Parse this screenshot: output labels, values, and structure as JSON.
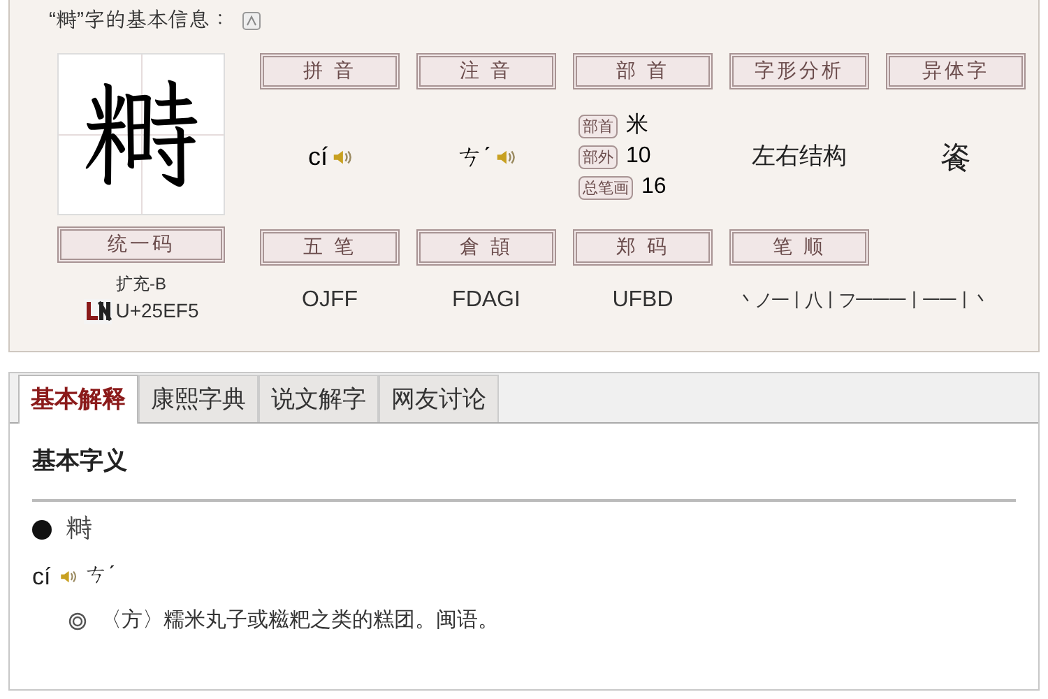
{
  "info_title": "“𥻵”字的基本信息：",
  "character": "𥻵",
  "top_fields": [
    {
      "header": "拼 音",
      "kind": "audio",
      "value": "cí"
    },
    {
      "header": "注 音",
      "kind": "audio",
      "value": "ㄘˊ"
    },
    {
      "header": "部 首",
      "kind": "parts",
      "parts": [
        {
          "tag": "部首",
          "value": "米"
        },
        {
          "tag": "部外",
          "value": "10"
        },
        {
          "tag": "总笔画",
          "value": "16"
        }
      ]
    },
    {
      "header": "字形分析",
      "kind": "text",
      "value": "左右结构"
    },
    {
      "header": "异体字",
      "kind": "large",
      "value": "餈"
    }
  ],
  "unicode": {
    "header": "统一码",
    "block": "扩充-B",
    "code": "U+25EF5"
  },
  "bottom_fields": [
    {
      "header": "五 笔",
      "value": "OJFF"
    },
    {
      "header": "倉 頡",
      "value": "FDAGI"
    },
    {
      "header": "郑 码",
      "value": "UFBD"
    },
    {
      "header": "笔 顺",
      "value": "丶ノ一丨八丨フ一一一丨一一丨丶"
    }
  ],
  "tabs": [
    {
      "label": "基本解释",
      "selected": true
    },
    {
      "label": "康熙字典",
      "selected": false
    },
    {
      "label": "说文解字",
      "selected": false
    },
    {
      "label": "网友讨论",
      "selected": false
    }
  ],
  "section_heading": "基本字义",
  "entry_char": "𥻵",
  "entry_pinyin": "cí",
  "entry_zhuyin": "ㄘˊ",
  "definition": "〈方〉糯米丸子或糍粑之类的糕团。闽语。"
}
